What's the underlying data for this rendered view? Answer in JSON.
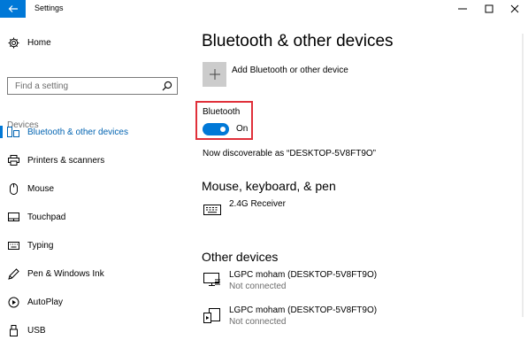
{
  "window": {
    "title": "Settings",
    "back_icon": "arrow-left-icon",
    "controls": [
      "minimize-icon",
      "maximize-icon",
      "close-icon"
    ]
  },
  "sidebar": {
    "home_label": "Home",
    "search": {
      "placeholder": "Find a setting",
      "value": ""
    },
    "section_label": "Devices",
    "items": [
      {
        "label": "Bluetooth & other devices",
        "icon": "bluetooth-devices-icon",
        "active": true
      },
      {
        "label": "Printers & scanners",
        "icon": "printer-icon",
        "active": false
      },
      {
        "label": "Mouse",
        "icon": "mouse-icon",
        "active": false
      },
      {
        "label": "Touchpad",
        "icon": "touchpad-icon",
        "active": false
      },
      {
        "label": "Typing",
        "icon": "keyboard-icon",
        "active": false
      },
      {
        "label": "Pen & Windows Ink",
        "icon": "pen-icon",
        "active": false
      },
      {
        "label": "AutoPlay",
        "icon": "autoplay-icon",
        "active": false
      },
      {
        "label": "USB",
        "icon": "usb-icon",
        "active": false
      }
    ]
  },
  "main": {
    "title": "Bluetooth & other devices",
    "add_device_label": "Add Bluetooth or other device",
    "bluetooth": {
      "label": "Bluetooth",
      "state": "On",
      "enabled": true
    },
    "discoverable_text": "Now discoverable as “DESKTOP-5V8FT9O”",
    "mouse_section": {
      "heading": "Mouse, keyboard, & pen",
      "devices": [
        {
          "name": "2.4G Receiver",
          "status": "",
          "icon": "keyboard-icon"
        }
      ]
    },
    "other_section": {
      "heading": "Other devices",
      "devices": [
        {
          "name": "LGPC moham (DESKTOP-5V8FT9O)",
          "status": "Not connected",
          "icon": "network-pc-icon"
        },
        {
          "name": "LGPC moham (DESKTOP-5V8FT9O)",
          "status": "Not connected",
          "icon": "media-pc-icon"
        }
      ]
    }
  },
  "colors": {
    "accent": "#0078d7",
    "highlight_border": "#e0303a",
    "sidebar_active_text": "#0063b1"
  }
}
